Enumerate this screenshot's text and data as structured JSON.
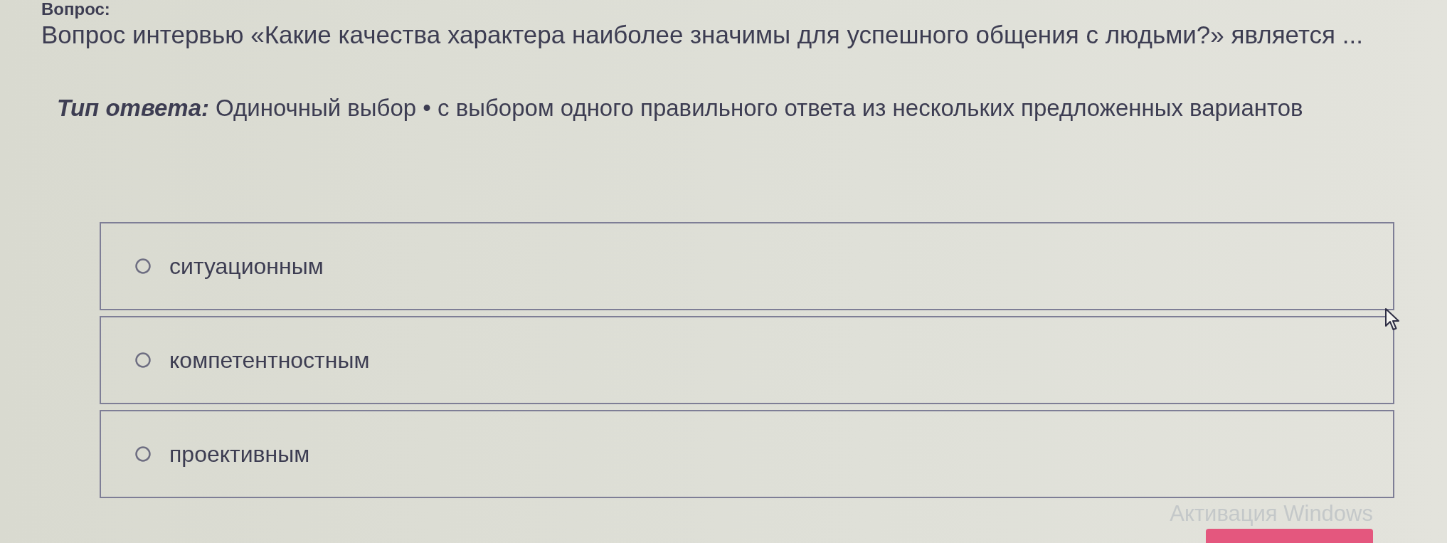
{
  "section_label": "Вопрос:",
  "question": "Вопрос интервью «Какие качества характера наиболее значимы для успешного общения с людьми?» является ...",
  "answer_type": {
    "label": "Тип ответа:",
    "value": "Одиночный выбор • с выбором одного правильного ответа из нескольких предложенных вариантов"
  },
  "options": [
    {
      "label": "ситуационным",
      "selected": false
    },
    {
      "label": "компетентностным",
      "selected": false
    },
    {
      "label": "проективным",
      "selected": false
    }
  ],
  "system_notice": {
    "title": "Активация Windows"
  }
}
